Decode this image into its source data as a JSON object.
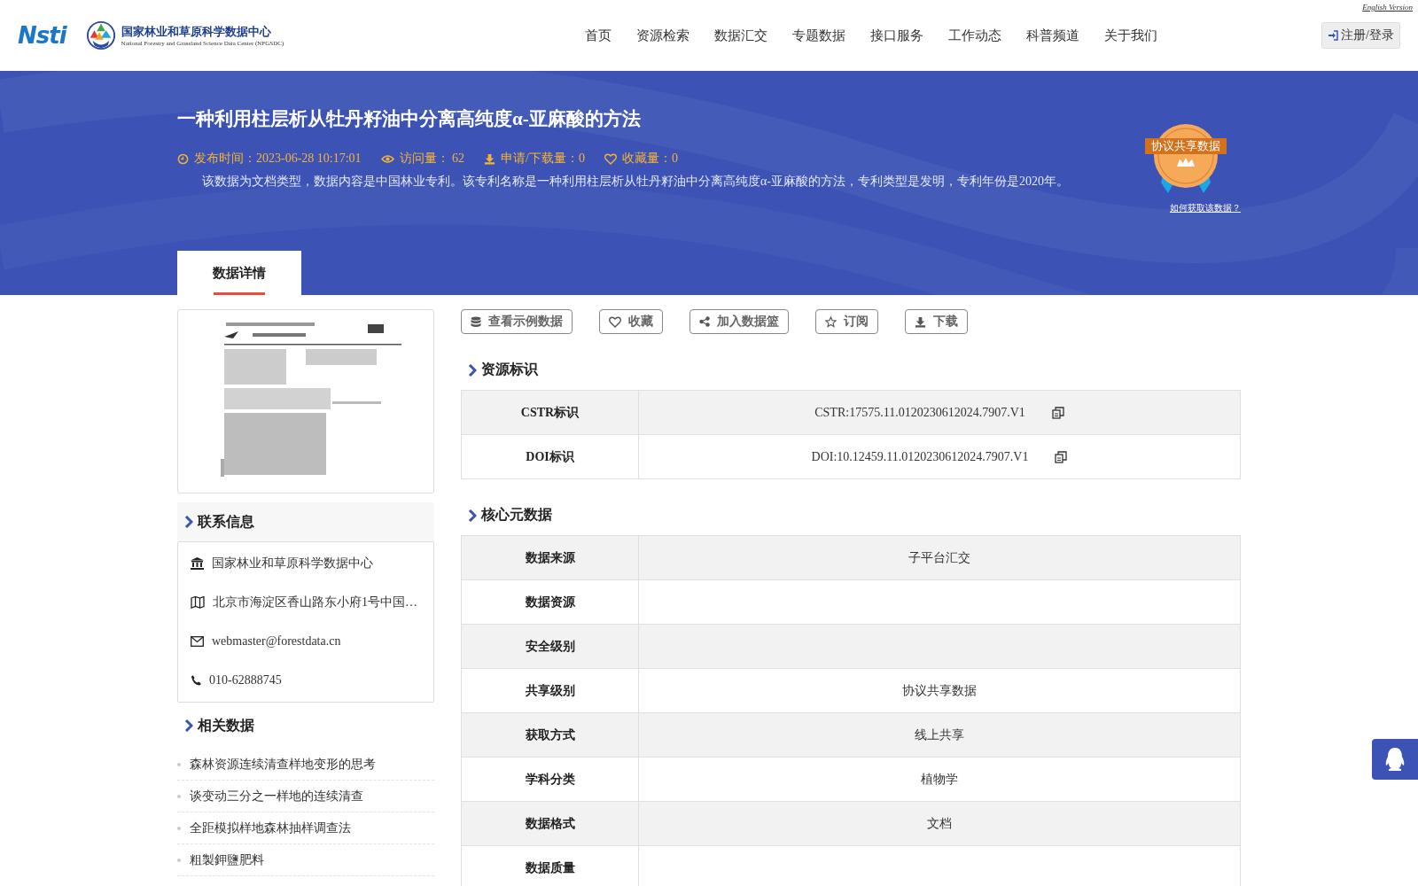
{
  "header": {
    "logo_text": "Nsti",
    "center_name": "国家林业和草原科学数据中心",
    "center_subtitle": "National Forestry and Grassland Science Data Center (NFGSDC)",
    "nav": [
      {
        "label": "首页",
        "selected": false
      },
      {
        "label": "资源检索",
        "selected": false
      },
      {
        "label": "数据汇交",
        "selected": false
      },
      {
        "label": "专题数据",
        "selected": false
      },
      {
        "label": "接口服务",
        "selected": false
      },
      {
        "label": "工作动态",
        "selected": false
      },
      {
        "label": "科普频道",
        "selected": false
      },
      {
        "label": "关于我们",
        "selected": false
      }
    ],
    "english_link": "English Version",
    "login_button": "注册/登录"
  },
  "banner": {
    "title": "一种利用柱层析从牡丹籽油中分离高纯度α-亚麻酸的方法",
    "meta": [
      {
        "kind": "time",
        "text": "发布时间：2023-06-28 10:17:01"
      },
      {
        "kind": "views",
        "text": "访问量： 62"
      },
      {
        "kind": "downloads",
        "text": "申请/下载量：0"
      },
      {
        "kind": "favorites",
        "text": "收藏量：0"
      }
    ],
    "description": "该数据为文档类型，数据内容是中国林业专利。该专利名称是一种利用柱层析从牡丹籽油中分离高纯度α-亚麻酸的方法，专利类型是发明，专利年份是2020年。",
    "badge_text": "协议共享数据",
    "badge_link": "如何获取该数据？"
  },
  "tabs": [
    {
      "label": "数据详情",
      "selected": true
    }
  ],
  "contact": {
    "heading": "联系信息",
    "items": [
      {
        "kind": "org",
        "text": "国家林业和草原科学数据中心"
      },
      {
        "kind": "address",
        "text": "北京市海淀区香山路东小府1号中国…"
      },
      {
        "kind": "email",
        "text": "webmaster@forestdata.cn"
      },
      {
        "kind": "phone",
        "text": "010-62888745"
      }
    ]
  },
  "related": {
    "heading": "相关数据",
    "items": [
      "森林资源连续清查样地变形的思考",
      "谈变动三分之一样地的连续清查",
      "全距模拟样地森林抽样调查法",
      "粗製鉀鹽肥料"
    ]
  },
  "actions": [
    {
      "kind": "sample",
      "label": "查看示例数据"
    },
    {
      "kind": "favorite",
      "label": "收藏"
    },
    {
      "kind": "basket",
      "label": "加入数据篮"
    },
    {
      "kind": "subscribe",
      "label": "订阅"
    },
    {
      "kind": "download",
      "label": "下载"
    }
  ],
  "resource_id": {
    "heading": "资源标识",
    "rows": [
      {
        "label": "CSTR标识",
        "value": "CSTR:17575.11.0120230612024.7907.V1",
        "copyable": true
      },
      {
        "label": "DOI标识",
        "value": "DOI:10.12459.11.0120230612024.7907.V1",
        "copyable": true
      }
    ]
  },
  "core_metadata": {
    "heading": "核心元数据",
    "rows": [
      {
        "label": "数据来源",
        "value": "子平台汇交"
      },
      {
        "label": "数据资源"
      },
      {
        "label": "安全级别"
      },
      {
        "label": "共享级别",
        "value": "协议共享数据"
      },
      {
        "label": "获取方式",
        "value": "线上共享"
      },
      {
        "label": "学科分类",
        "value": "植物学"
      },
      {
        "label": "数据格式",
        "value": "文档"
      },
      {
        "label": "数据质量"
      }
    ]
  }
}
